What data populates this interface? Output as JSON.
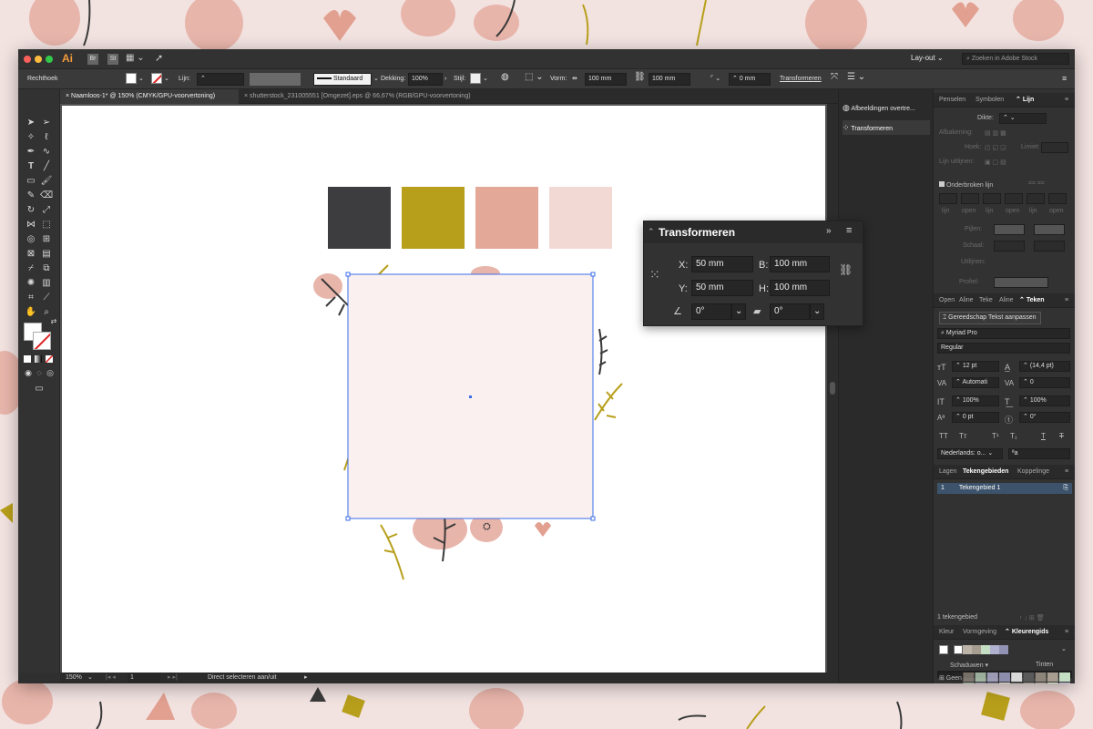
{
  "colors": {
    "swatch_dark": "#3d3d3f",
    "swatch_olive": "#b89f1b",
    "swatch_salmon": "#e4a898",
    "swatch_blush": "#f2d9d4",
    "selected_fill": "#fbf0f0",
    "selection_blue": "#3a6ee8"
  },
  "app": {
    "logo": "Ai",
    "br": "Br",
    "st": "St",
    "workspace": "Lay-out",
    "stock_search_placeholder": "Zoeken in Adobe Stock"
  },
  "control": {
    "tool_name": "Rechthoek",
    "stroke_label": "Lijn:",
    "stroke_profile": "Standaard",
    "opacity_label": "Dekking:",
    "opacity_value": "100%",
    "style_label": "Stijl:",
    "shape_label": "Vorm:",
    "width_value": "100 mm",
    "height_value": "100 mm",
    "corner_value": "0 mm",
    "transform_link": "Transformeren"
  },
  "tabs": [
    {
      "label": "Naamloos-1* @ 150% (CMYK/GPU-voorvertoning)"
    },
    {
      "label": "shutterstock_231005551 [Omgezet].eps @ 66,67% (RGB/GPU-voorvertoning)"
    }
  ],
  "status": {
    "zoom": "150%",
    "artboard": "1",
    "tool_hint": "Direct selecteren aan/uit"
  },
  "dock": {
    "item1": "Afbeeldingen overtre...",
    "item2": "Transformeren"
  },
  "transform": {
    "title": "Transformeren",
    "x_label": "X:",
    "x_value": "50 mm",
    "y_label": "Y:",
    "y_value": "50 mm",
    "w_label": "B:",
    "w_value": "100 mm",
    "h_label": "H:",
    "h_value": "100 mm",
    "rotate_value": "0°",
    "shear_value": "0°"
  },
  "stroke_panel": {
    "tabs": [
      "Penselen",
      "Symbolen",
      "Lijn"
    ],
    "weight_label": "Dikte:",
    "cap_label": "Afbakening:",
    "corner_label": "Hoek:",
    "limit_label": "Limiet:",
    "align_label": "Lijn uitlijnen:",
    "dashed_label": "Onderbroken lijn",
    "dash_labels": [
      "lijn",
      "open",
      "lijn",
      "open",
      "lijn",
      "open"
    ],
    "arrow_label": "Pijlen:",
    "scale_label": "Schaal:",
    "align2_label": "Uitlijnen:",
    "profile_label": "Profiel:"
  },
  "char_panel": {
    "tabs": [
      "Open",
      "Aline",
      "Teke",
      "Aline",
      "Teken"
    ],
    "touch_button": "Gereedschap Tekst aanpassen",
    "font": "Myriad Pro",
    "style": "Regular",
    "size": "12 pt",
    "leading": "(14,4 pt)",
    "kerning": "Automati",
    "tracking": "0",
    "vscale": "100%",
    "hscale": "100%",
    "baseline": "0 pt",
    "rotate": "0°",
    "caps": [
      "TT",
      "Tᴛ",
      "T¹",
      "T₁",
      "T",
      "T"
    ],
    "language": "Nederlands: o...",
    "aa": "ªa"
  },
  "artboards_panel": {
    "tabs": [
      "Lagen",
      "Tekengebieden",
      "Koppelinge"
    ],
    "row_index": "1",
    "row_name": "Tekengebied 1",
    "count": "1 tekengebied"
  },
  "guide_panel": {
    "tabs": [
      "Kleur",
      "Vormgeving",
      "Kleurengids"
    ],
    "shades": "Schaduwen",
    "tints": "Tinten",
    "none": "Geen"
  }
}
